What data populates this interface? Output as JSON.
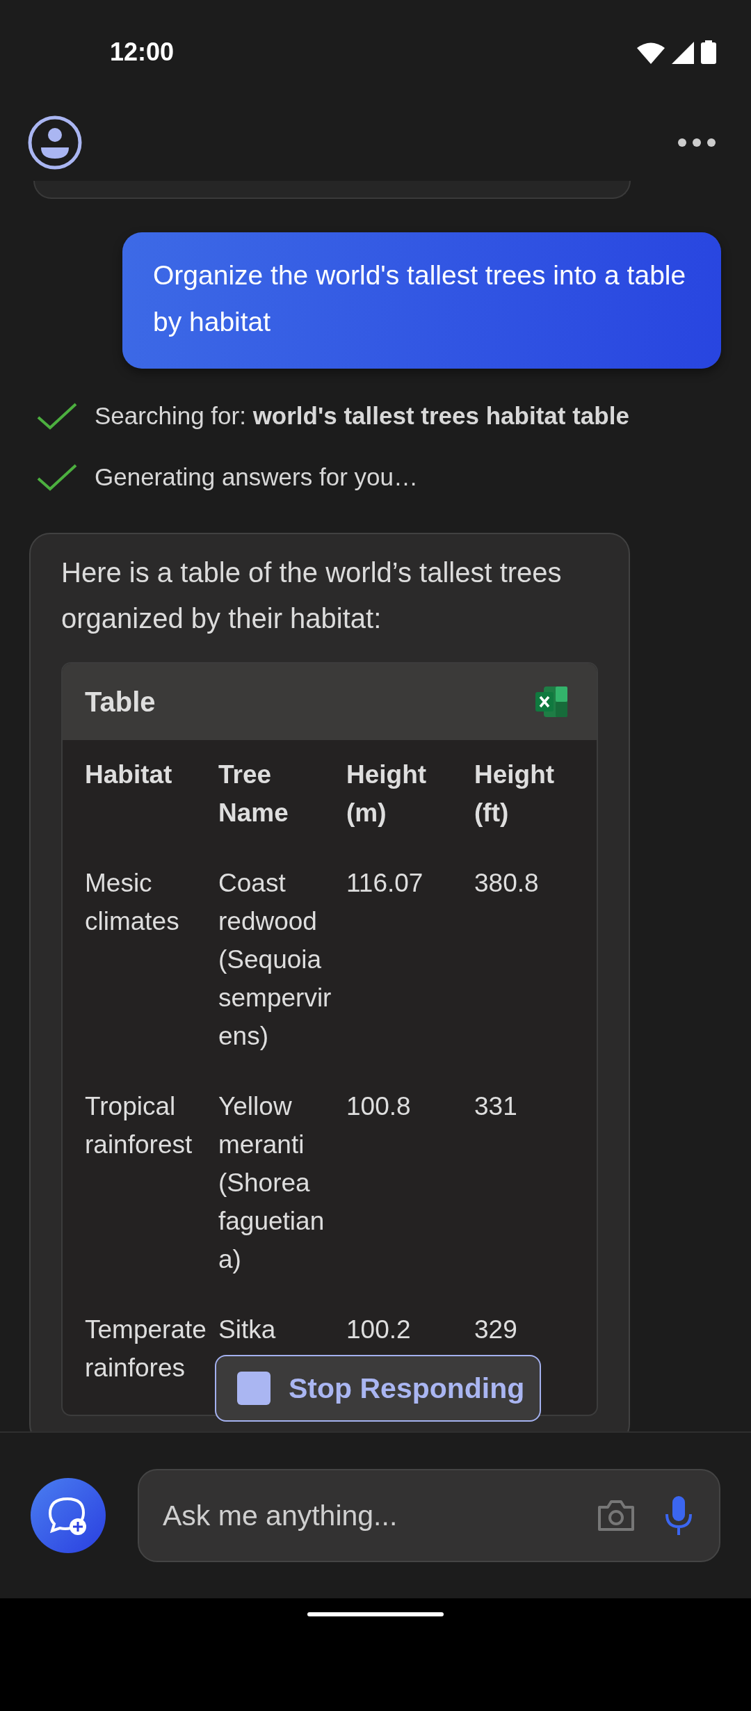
{
  "status_bar": {
    "time": "12:00"
  },
  "user_message": "Organize the world's tallest trees into a table by habitat",
  "progress_steps": [
    {
      "text": "Searching for: **world's tallest trees habitat table**",
      "done": true
    },
    {
      "text": "Generating answers for you…",
      "done": true
    }
  ],
  "answer": {
    "intro": "Here is a table of the world’s tallest trees organized by their habitat:",
    "table": {
      "title": "Table",
      "columns": [
        "Habitat",
        "Tree Name",
        "Height (m)",
        "Height (ft)"
      ],
      "rows": [
        [
          "Mesic climates",
          "Coast redwood (Sequoia sempervirens)",
          "116.07",
          "380.8"
        ],
        [
          "Tropical rainforest",
          "Yellow meranti (Shorea faguetiana)",
          "100.8",
          "331"
        ],
        [
          "Temperate rainfores",
          "Sitka",
          "100.2",
          "329"
        ]
      ]
    }
  },
  "stop_button": "Stop Responding",
  "composer": {
    "placeholder": "Ask me anything..."
  }
}
